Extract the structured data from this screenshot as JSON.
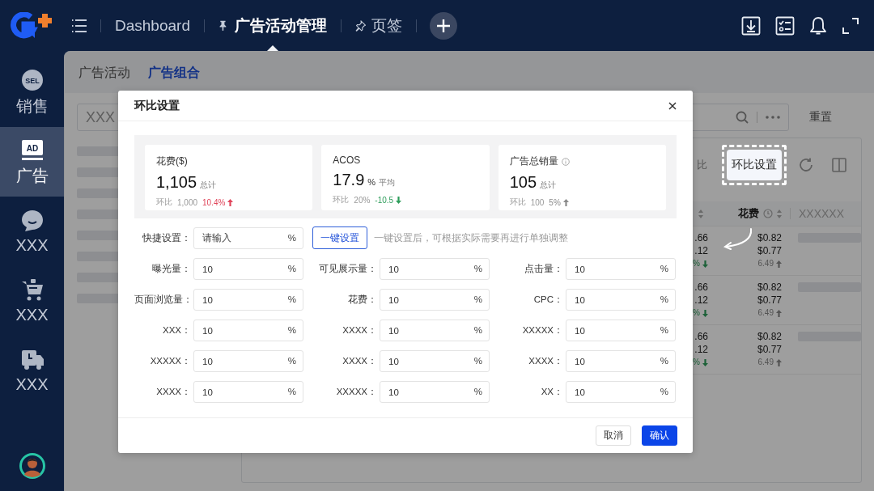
{
  "topbar": {
    "nav": [
      {
        "label": "Dashboard",
        "kind": "plain",
        "selected": false
      },
      {
        "label": "广告活动管理",
        "kind": "pinned",
        "selected": true
      },
      {
        "label": "页签",
        "kind": "pin",
        "selected": false
      }
    ]
  },
  "sidebar": {
    "items": [
      {
        "label": "销售",
        "icon_text": "SEL",
        "selected": false
      },
      {
        "label": "广告",
        "icon_text": "AD",
        "selected": true
      },
      {
        "label": "XXX",
        "selected": false
      },
      {
        "label": "XXX",
        "selected": false
      },
      {
        "label": "XXX",
        "selected": false
      }
    ]
  },
  "page_tabs": [
    {
      "label": "广告活动",
      "selected": false
    },
    {
      "label": "广告组合",
      "selected": true
    }
  ],
  "filter": {
    "search_value": "XXX",
    "reset_button": "重置"
  },
  "table": {
    "toolbar_text": "比",
    "settings_button": "环比设置",
    "header": {
      "spend": "花费",
      "column_3": "XXXXXX"
    },
    "rows": [
      {
        "column_1": [
          ".66",
          ".12",
          "%"
        ],
        "column_1_rising": false,
        "spend": [
          "$0.82",
          "$0.77",
          "6.49"
        ],
        "spend_rising": true
      },
      {
        "column_1": [
          ".66",
          ".12",
          "%"
        ],
        "column_1_rising": false,
        "spend": [
          "$0.82",
          "$0.77",
          "6.49"
        ],
        "spend_rising": true
      },
      {
        "column_1": [
          ".66",
          ".12",
          "%"
        ],
        "column_1_rising": false,
        "spend": [
          "$0.82",
          "$0.77",
          "6.49"
        ],
        "spend_rising": true
      }
    ]
  },
  "modal": {
    "title": "环比设置",
    "stats": [
      {
        "label": "花费($)",
        "info": false,
        "value": "1,105",
        "unit": "总计",
        "compare_label": "环比",
        "compare_value": "1,000",
        "change": "10.4%",
        "rising": true,
        "color": "#e0455a"
      },
      {
        "label": "ACOS",
        "info": false,
        "value": "17.9",
        "suffix": "%",
        "unit": "平均",
        "compare_label": "环比",
        "compare_value": "20%",
        "change": "-10.5",
        "rising": false,
        "color": "#2e9d5b"
      },
      {
        "label": "广告总销量",
        "info": true,
        "value": "105",
        "unit": "总计",
        "compare_label": "环比",
        "compare_value": "100",
        "change": "5%",
        "rising": true,
        "color": "#8a8a8a"
      }
    ],
    "quick": {
      "label": "快捷设置：",
      "placeholder": "请输入",
      "suffix": "%",
      "button": "一键设置",
      "hint": "一键设置后，可根据实际需要再进行单独调整"
    },
    "fields": [
      {
        "label": "曝光量：",
        "value": "10",
        "suffix": "%"
      },
      {
        "label": "可见展示量：",
        "value": "10",
        "suffix": "%"
      },
      {
        "label": "点击量：",
        "value": "10",
        "suffix": "%"
      },
      {
        "label": "页面浏览量：",
        "value": "10",
        "suffix": "%"
      },
      {
        "label": "花费：",
        "value": "10",
        "suffix": "%"
      },
      {
        "label": "CPC：",
        "value": "10",
        "suffix": "%"
      },
      {
        "label": "XXX：",
        "value": "10",
        "suffix": "%"
      },
      {
        "label": "XXXX：",
        "value": "10",
        "suffix": "%"
      },
      {
        "label": "XXXXX：",
        "value": "10",
        "suffix": "%"
      },
      {
        "label": "XXXXX：",
        "value": "10",
        "suffix": "%"
      },
      {
        "label": "XXXX：",
        "value": "10",
        "suffix": "%"
      },
      {
        "label": "XXXX：",
        "value": "10",
        "suffix": "%"
      },
      {
        "label": "XXXX：",
        "value": "10",
        "suffix": "%"
      },
      {
        "label": "XXXXX：",
        "value": "10",
        "suffix": "%"
      },
      {
        "label": "XX：",
        "value": "10",
        "suffix": "%"
      }
    ],
    "buttons": [
      {
        "label": "取消",
        "kind": "secondary"
      },
      {
        "label": "确认",
        "kind": "primary"
      }
    ]
  }
}
